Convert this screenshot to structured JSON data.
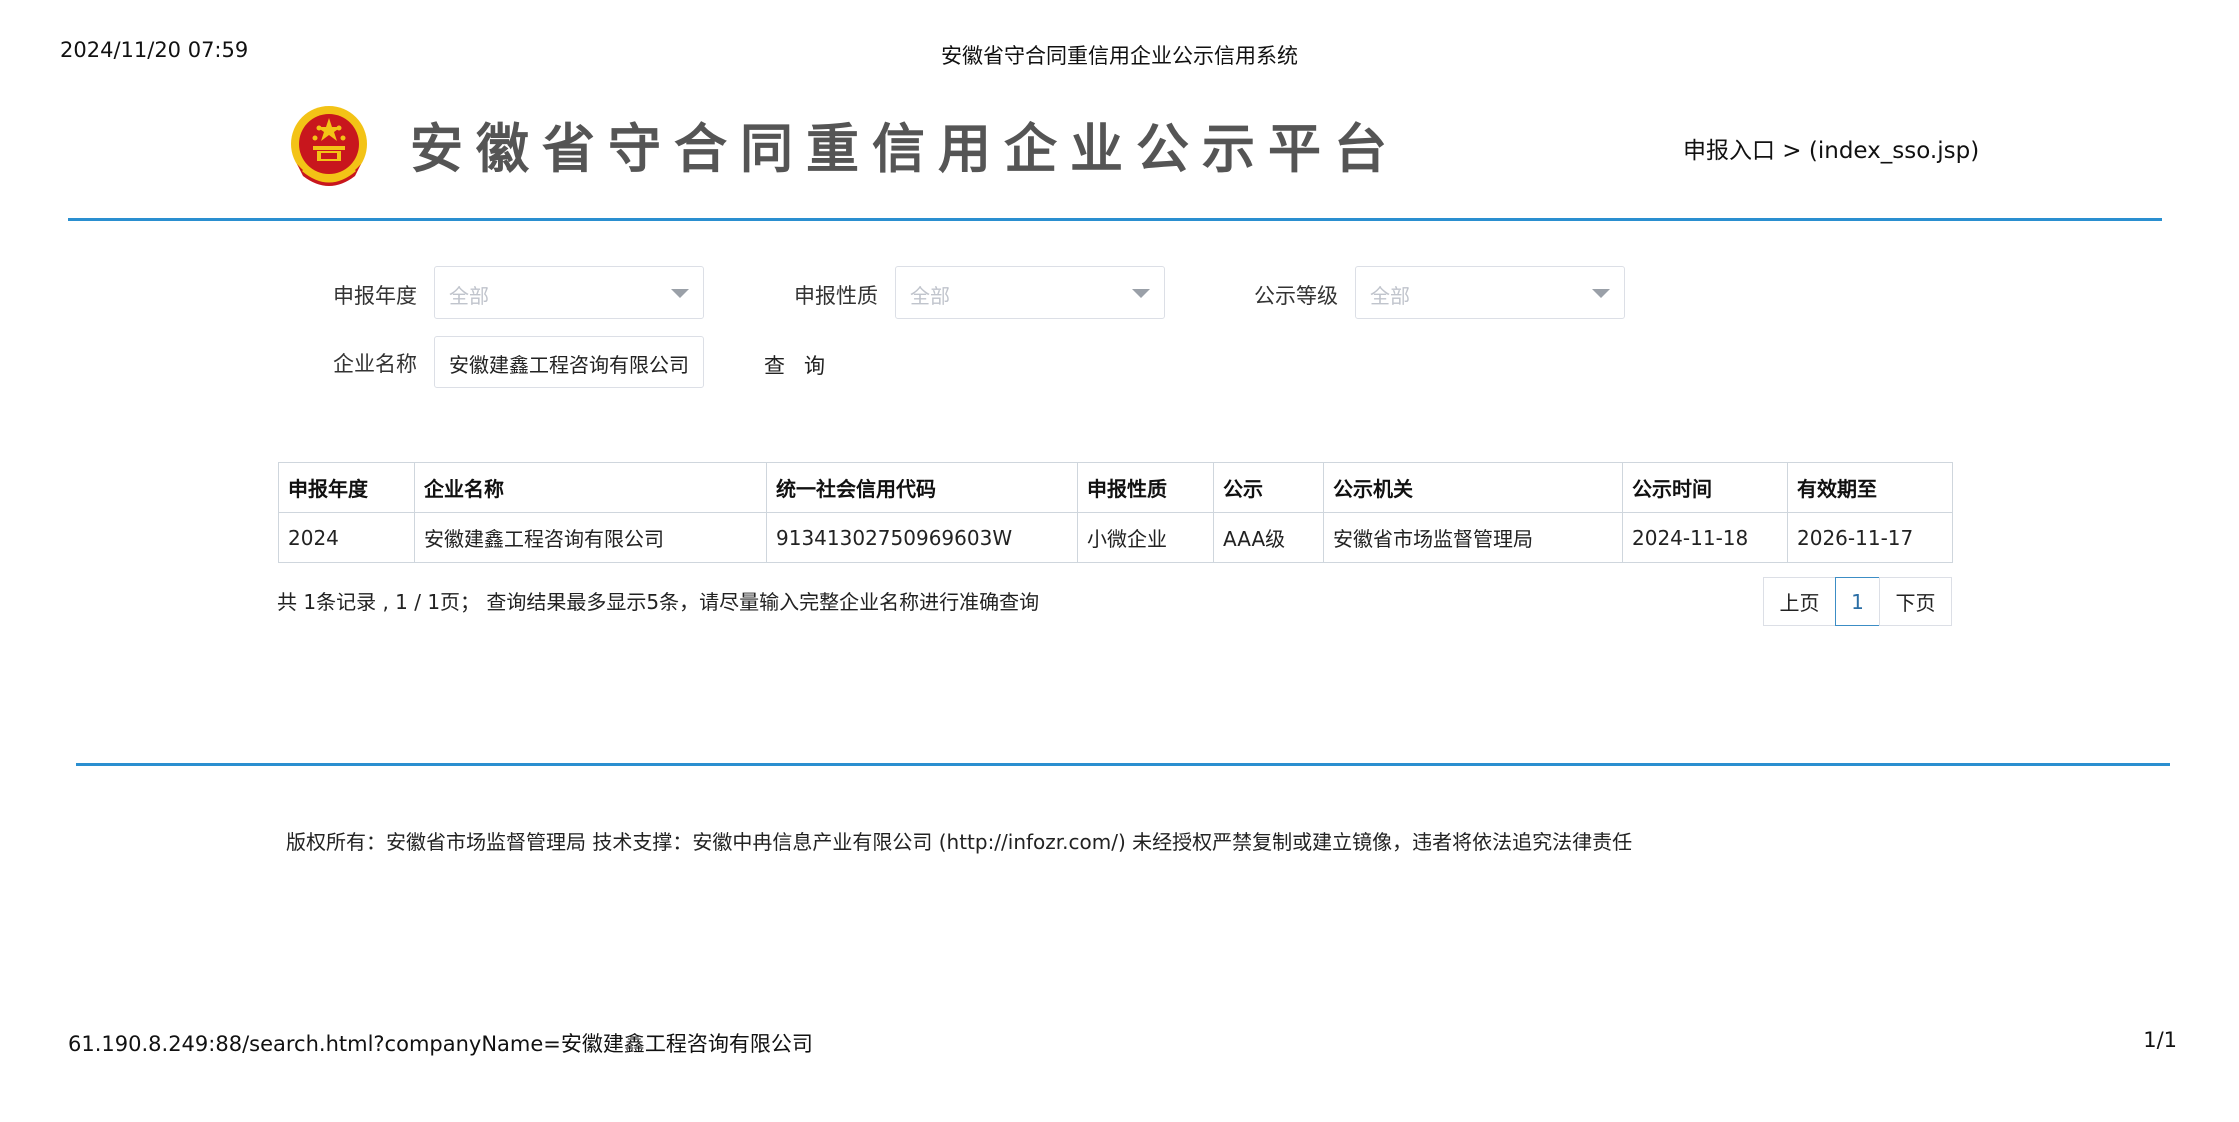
{
  "print_header": {
    "datetime": "2024/11/20 07:59",
    "doc_title": "安徽省守合同重信用企业公示信用系统"
  },
  "header": {
    "emblem_icon": "national-emblem-icon",
    "site_title": "安徽省守合同重信用企业公示平台",
    "report_link": "申报入口 > (index_sso.jsp)"
  },
  "filters": {
    "year": {
      "label": "申报年度",
      "value": "全部"
    },
    "nature": {
      "label": "申报性质",
      "value": "全部"
    },
    "level": {
      "label": "公示等级",
      "value": "全部"
    },
    "company": {
      "label": "企业名称",
      "value": "安徽建鑫工程咨询有限公司"
    },
    "query_label": "查询"
  },
  "table": {
    "headers": [
      "申报年度",
      "企业名称",
      "统一社会信用代码",
      "申报性质",
      "公示",
      "公示机关",
      "公示时间",
      "有效期至"
    ],
    "rows": [
      [
        "2024",
        "安徽建鑫工程咨询有限公司",
        "91341302750969603W",
        "小微企业",
        "AAA级",
        "安徽省市场监督管理局",
        "2024-11-18",
        "2026-11-17"
      ]
    ]
  },
  "summary": "共 1条记录 , 1 / 1页； 查询结果最多显示5条，请尽量输入完整企业名称进行准确查询",
  "pagination": {
    "prev": "上页",
    "current": "1",
    "next": "下页"
  },
  "footer": {
    "copyright": "版权所有：安徽省市场监督管理局  技术支撑：安徽中冉信息产业有限公司 (http://infozr.com/)  未经授权严禁复制或建立镜像，违者将依法追究法律责任"
  },
  "print_footer": {
    "url": "61.190.8.249:88/search.html?companyName=安徽建鑫工程咨询有限公司",
    "page": "1/1"
  },
  "colors": {
    "accent_rule": "#2a8fd0",
    "title_gray": "#555555",
    "emblem_red": "#c8161d",
    "emblem_gold": "#f3c316"
  }
}
